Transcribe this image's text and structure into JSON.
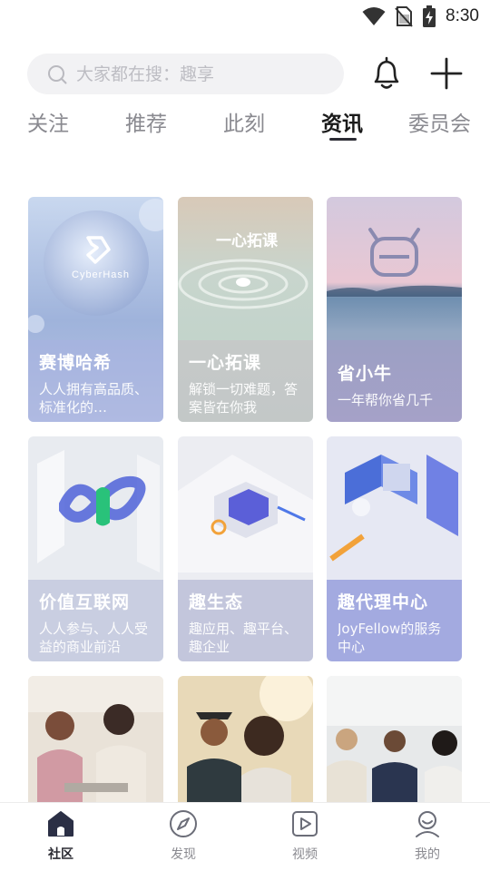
{
  "status_bar": {
    "time": "8:30",
    "icons": [
      "wifi-icon",
      "no-sim-icon",
      "battery-charging-icon"
    ]
  },
  "search": {
    "placeholder": "大家都在搜：趣享",
    "icon": "search-icon"
  },
  "header_actions": [
    "bell-icon",
    "plus-icon"
  ],
  "tabs": [
    {
      "label": "关注"
    },
    {
      "label": "推荐"
    },
    {
      "label": "此刻"
    },
    {
      "label": "资讯",
      "active": true
    },
    {
      "label": "委员会"
    }
  ],
  "cards": [
    {
      "title": "赛博哈希",
      "desc": "人人拥有高品质、标准化的…",
      "logo_text": "CyberHash"
    },
    {
      "title": "一心拓课",
      "desc": "解锁一切难题，答案皆在你我",
      "logo_text": "一心拓课"
    },
    {
      "title": "省小牛",
      "desc": "一年帮你省几千"
    },
    {
      "title": "价值互联网",
      "desc": "人人参与、人人受益的商业前沿"
    },
    {
      "title": "趣生态",
      "desc": "趣应用、趣平台、趣企业"
    },
    {
      "title": "趣代理中心",
      "desc": "JoyFellow的服务中心"
    },
    {
      "title": ""
    },
    {
      "title": ""
    },
    {
      "title": ""
    }
  ],
  "bottom_nav": [
    {
      "label": "社区",
      "icon": "home-icon",
      "active": true
    },
    {
      "label": "发现",
      "icon": "compass-icon"
    },
    {
      "label": "视频",
      "icon": "video-icon"
    },
    {
      "label": "我的",
      "icon": "profile-icon"
    }
  ]
}
